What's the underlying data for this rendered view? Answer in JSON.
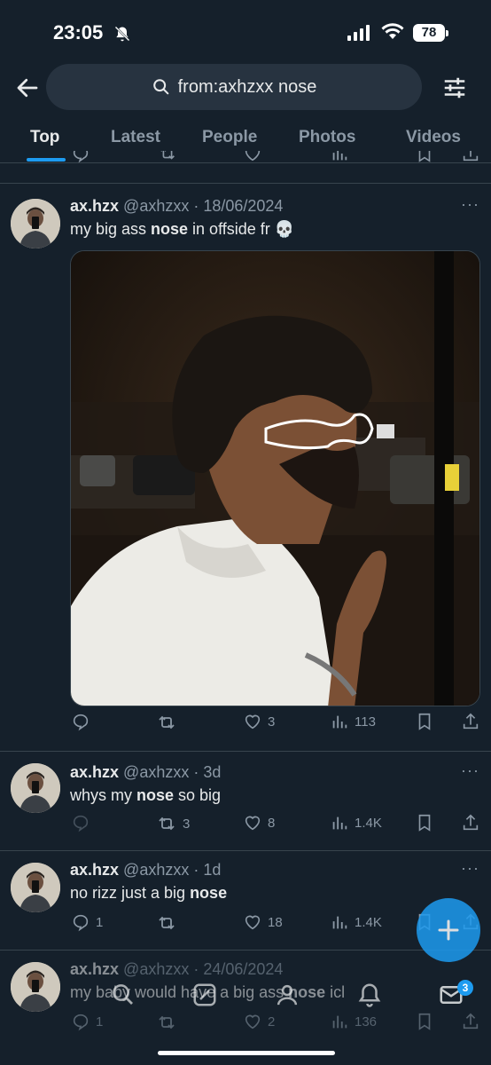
{
  "status_bar": {
    "time": "23:05",
    "battery": "78"
  },
  "search": {
    "query": "from:axhzxx nose"
  },
  "tabs": [
    {
      "label": "Top",
      "active": true
    },
    {
      "label": "Latest",
      "active": false
    },
    {
      "label": "People",
      "active": false
    },
    {
      "label": "Photos",
      "active": false
    },
    {
      "label": "Videos",
      "active": false
    }
  ],
  "colors": {
    "accent": "#1d9bf0",
    "background": "#15202b",
    "muted": "#8b98a5"
  },
  "tweets": [
    {
      "name": "ax.hzx",
      "handle": "@axhzxx",
      "time": "18/06/2024",
      "text_before": "my big ass ",
      "text_bold": "nose",
      "text_after": " in offside fr 💀",
      "replies": "",
      "retweets": "",
      "likes": "3",
      "views": "113"
    },
    {
      "name": "ax.hzx",
      "handle": "@axhzxx",
      "time": "3d",
      "text_before": "whys my ",
      "text_bold": "nose",
      "text_after": " so big",
      "replies": "",
      "retweets": "3",
      "likes": "8",
      "views": "1.4K"
    },
    {
      "name": "ax.hzx",
      "handle": "@axhzxx",
      "time": "1d",
      "text_before": "no rizz just a big ",
      "text_bold": "nose",
      "text_after": "",
      "replies": "1",
      "retweets": "",
      "likes": "18",
      "views": "1.4K"
    },
    {
      "name": "ax.hzx",
      "handle": "@axhzxx",
      "time": "24/06/2024",
      "text_before": "my baby would have a big ass ",
      "text_bold": "nose",
      "text_after": " icl",
      "replies": "1",
      "retweets": "",
      "likes": "2",
      "views": "136"
    }
  ],
  "bottom_nav": {
    "messages_badge": "3"
  },
  "icons": [
    "back-arrow-icon",
    "search-icon",
    "filter-icon",
    "reply-icon",
    "retweet-icon",
    "like-icon",
    "views-icon",
    "bookmark-icon",
    "share-icon",
    "compose-icon",
    "home-icon",
    "grok-icon",
    "communities-icon",
    "notifications-icon",
    "messages-icon"
  ]
}
